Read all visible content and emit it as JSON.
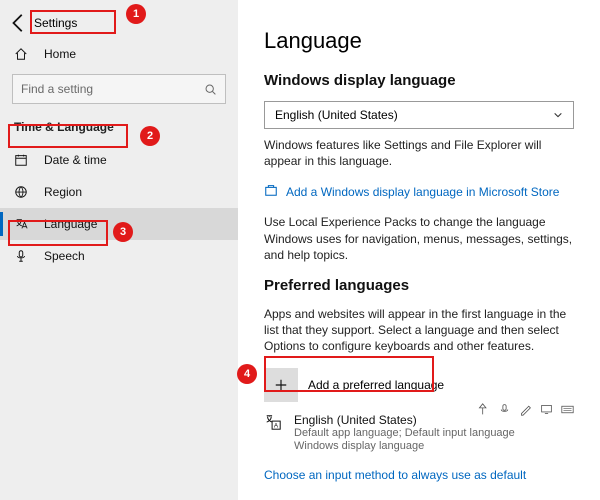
{
  "header": {
    "title": "Settings"
  },
  "search": {
    "placeholder": "Find a setting"
  },
  "sidebar": {
    "home": "Home",
    "section": "Time & Language",
    "items": [
      {
        "label": "Date & time"
      },
      {
        "label": "Region"
      },
      {
        "label": "Language"
      },
      {
        "label": "Speech"
      }
    ]
  },
  "main": {
    "h1": "Language",
    "display_h2": "Windows display language",
    "display_value": "English (United States)",
    "display_desc": "Windows features like Settings and File Explorer will appear in this language.",
    "store_link": "Add a Windows display language in Microsoft Store",
    "packs_desc": "Use Local Experience Packs to change the language Windows uses for navigation, menus, messages, settings, and help topics.",
    "preferred_h2": "Preferred languages",
    "preferred_desc": "Apps and websites will appear in the first language in the list that they support. Select a language and then select Options to configure keyboards and other features.",
    "add_label": "Add a preferred language",
    "lang_name": "English (United States)",
    "lang_meta1": "Default app language; Default input language",
    "lang_meta2": "Windows display language",
    "default_link": "Choose an input method to always use as default"
  },
  "annotations": {
    "m1": "1",
    "m2": "2",
    "m3": "3",
    "m4": "4"
  }
}
